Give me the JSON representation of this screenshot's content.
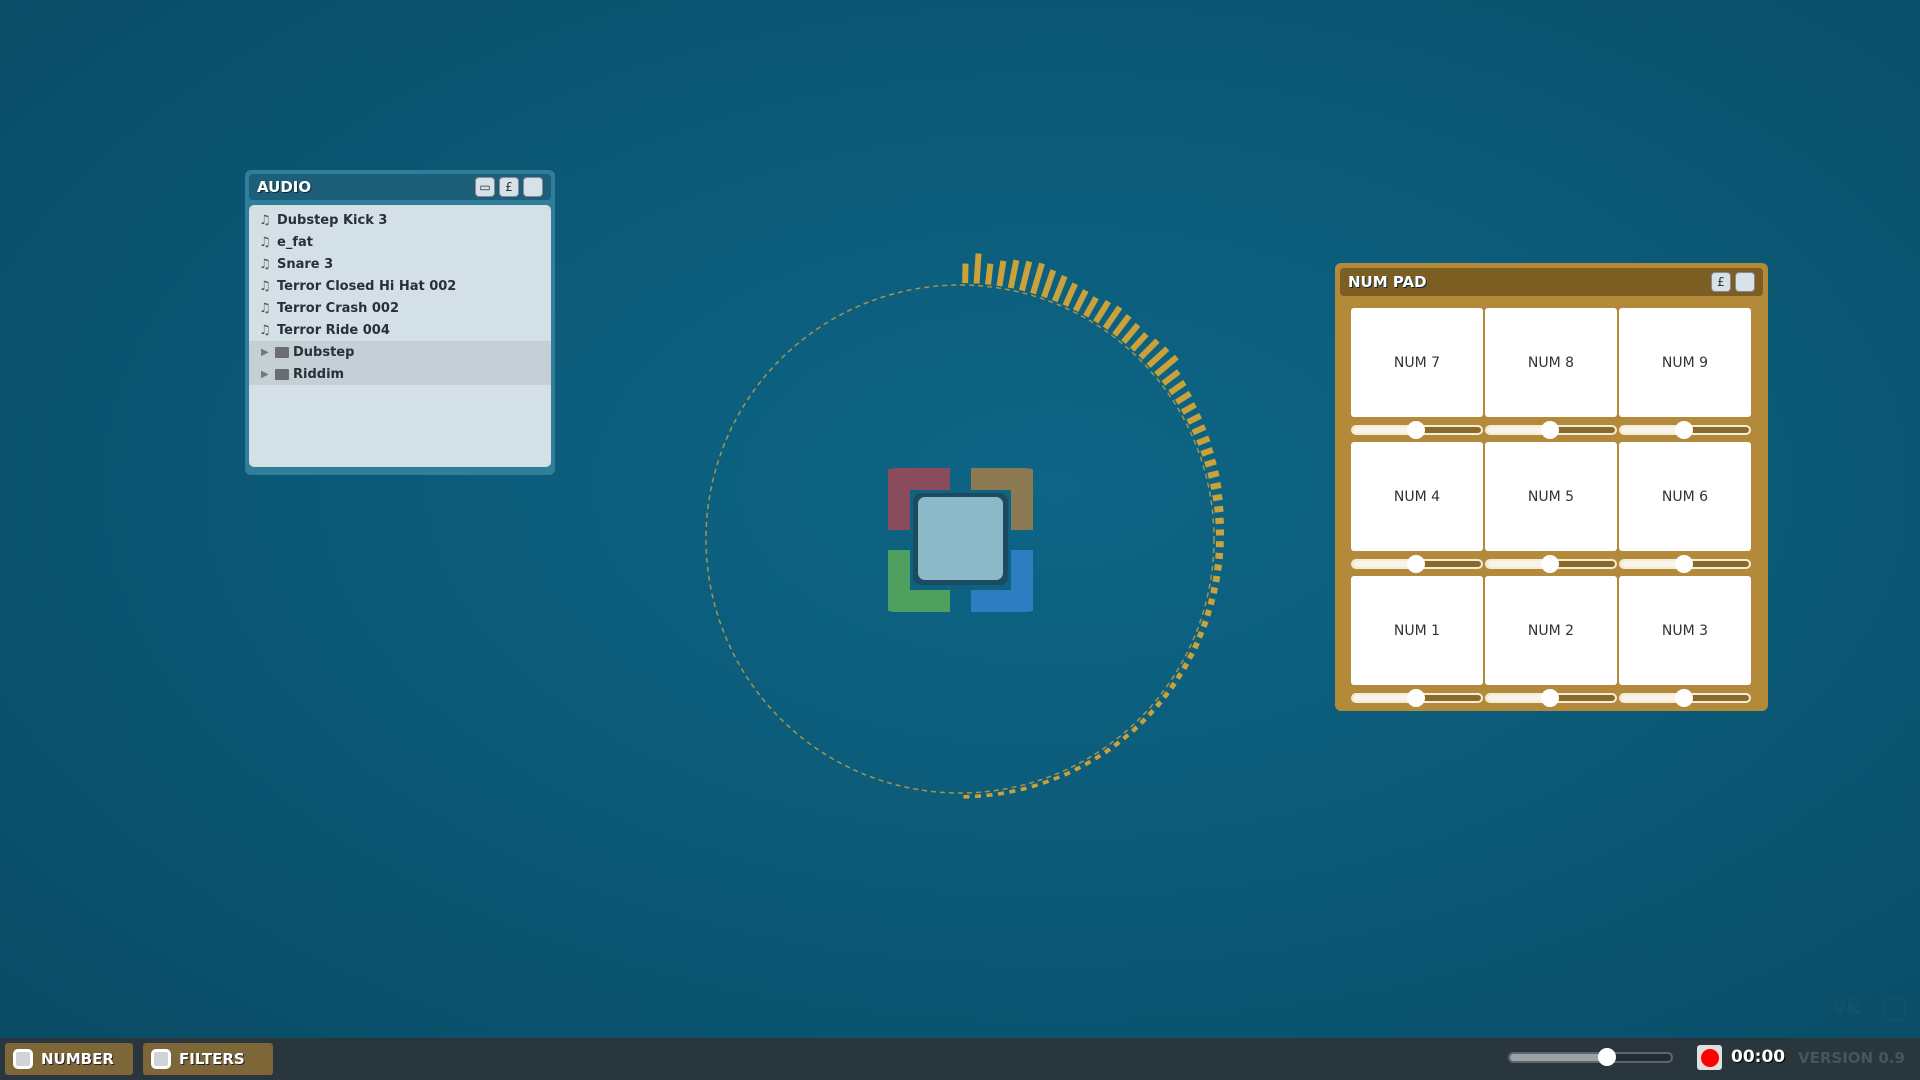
{
  "audio_panel": {
    "title": "AUDIO",
    "buttons": [
      {
        "icon": "folder-icon",
        "glyph": "▭"
      },
      {
        "icon": "pin-icon",
        "glyph": "£"
      },
      {
        "icon": "window-icon",
        "glyph": ""
      }
    ],
    "files": [
      "Dubstep Kick 3",
      "e_fat",
      "Snare 3",
      "Terror Closed Hi Hat 002",
      "Terror Crash 002",
      "Terror Ride 004"
    ],
    "folders": [
      "Dubstep",
      "Riddim"
    ],
    "file_glyph": "♫",
    "folder_arrow": "▶"
  },
  "numpad_panel": {
    "title": "NUM PAD",
    "buttons": [
      {
        "icon": "pin-icon",
        "glyph": "£"
      },
      {
        "icon": "window-icon",
        "glyph": ""
      }
    ],
    "rows": [
      {
        "keys": [
          "NUM 7",
          "NUM 8",
          "NUM 9"
        ],
        "sliders": [
          0.49,
          0.49,
          0.49
        ]
      },
      {
        "keys": [
          "NUM 4",
          "NUM 5",
          "NUM 6"
        ],
        "sliders": [
          0.49,
          0.49,
          0.49
        ]
      },
      {
        "keys": [
          "NUM 1",
          "NUM 2",
          "NUM 3"
        ],
        "sliders": [
          0.49,
          0.49,
          0.49
        ]
      }
    ]
  },
  "visualizer": {
    "bar_color": "#c9a23c",
    "spectrum": [
      0.55,
      0.9,
      0.6,
      0.75,
      0.85,
      0.9,
      0.95,
      0.85,
      0.8,
      0.7,
      0.65,
      0.6,
      0.7,
      0.75,
      0.7,
      0.65,
      0.6,
      0.7,
      0.75,
      0.8,
      0.55,
      0.5,
      0.45,
      0.4,
      0.38,
      0.35,
      0.33,
      0.3,
      0.28,
      0.27,
      0.25,
      0.22,
      0.2,
      0.18,
      0.17,
      0.16,
      0.15,
      0.14,
      0.13,
      0.12,
      0.11,
      0.1,
      0.1,
      0.09,
      0.09,
      0.08,
      0.08,
      0.07,
      0.07,
      0.06,
      0.06,
      0.05,
      0.05,
      0.05,
      0.04,
      0.04,
      0.04,
      0.03,
      0.03,
      0.03,
      0.03,
      0.02,
      0.02,
      0.02,
      0.02,
      0.02,
      0.02,
      0.02,
      0.02,
      0.02
    ]
  },
  "bottom_bar": {
    "buttons": [
      "NUMBER",
      "FILTERS"
    ],
    "volume": 0.6,
    "time": "00:00",
    "version": "VERSION 0.9",
    "social": [
      {
        "icon": "vk-icon",
        "glyph": "vk"
      },
      {
        "icon": "twitter-icon",
        "glyph": "▢"
      }
    ]
  }
}
